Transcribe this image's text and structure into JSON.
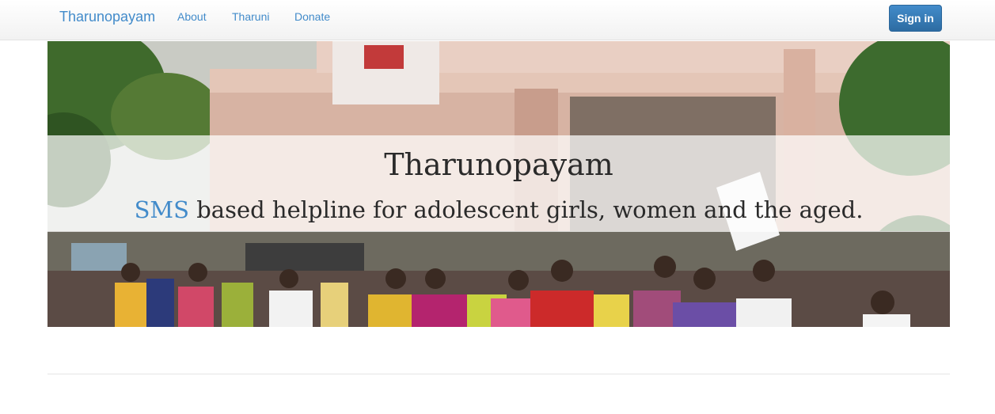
{
  "navbar": {
    "brand": "Tharunopayam",
    "links": [
      {
        "label": "About"
      },
      {
        "label": "Tharuni"
      },
      {
        "label": "Donate"
      }
    ],
    "signin_label": "Sign in"
  },
  "hero": {
    "title": "Tharunopayam",
    "subtitle_highlight": "SMS",
    "subtitle_rest": " based helpline for adolescent girls, women and the aged.",
    "image_description_icon": "photo-of-girls-walking"
  },
  "colors": {
    "link": "#428bca",
    "button": "#428bca",
    "highlight": "#428bca"
  }
}
